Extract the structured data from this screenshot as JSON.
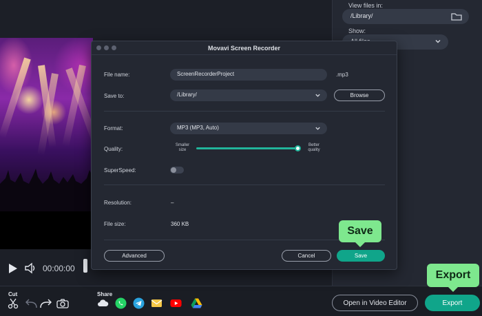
{
  "right_panel": {
    "view_files_label": "View files in:",
    "path_value": "/Library/",
    "show_label": "Show:",
    "show_value": "All files"
  },
  "player": {
    "timecode": "00:00:00"
  },
  "toolbar": {
    "cut_label": "Cut",
    "share_label": "Share",
    "open_editor_label": "Open in Video Editor",
    "export_label": "Export"
  },
  "dialog": {
    "title": "Movavi Screen Recorder",
    "file_name_label": "File name:",
    "file_name_value": "ScreenRecorderProject",
    "file_extension": ".mp3",
    "save_to_label": "Save to:",
    "save_to_value": "/Library/",
    "browse_label": "Browse",
    "format_label": "Format:",
    "format_value": "MP3 (MP3, Auto)",
    "quality_label": "Quality:",
    "quality_min_label": "Smaller size",
    "quality_max_label": "Better quality",
    "quality_level": 1.0,
    "superspeed_label": "SuperSpeed:",
    "superspeed_on": false,
    "resolution_label": "Resolution:",
    "resolution_value": "–",
    "file_size_label": "File size:",
    "file_size_value": "360 KB",
    "advanced_label": "Advanced",
    "cancel_label": "Cancel",
    "save_label": "Save"
  },
  "callouts": {
    "save": "Save",
    "export": "Export"
  },
  "colors": {
    "accent": "#10a58a",
    "callout": "#7ee88e",
    "background": "#1c1f27",
    "dialog": "#242832"
  },
  "icons": [
    "folder-icon",
    "chevron-down-icon",
    "play-icon",
    "volume-icon",
    "scissors-icon",
    "undo-icon",
    "redo-icon",
    "camera-icon",
    "cloud-icon",
    "whatsapp-icon",
    "telegram-icon",
    "email-icon",
    "youtube-icon",
    "google-drive-icon"
  ]
}
